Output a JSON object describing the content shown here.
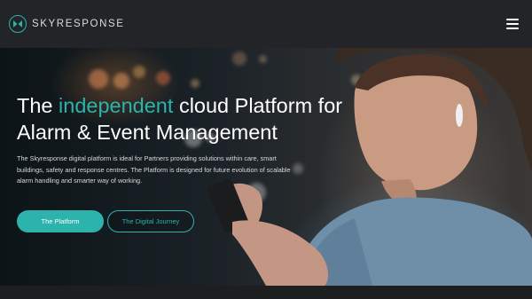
{
  "header": {
    "logo_text": "SKYRESPONSE",
    "logo_icon": "skyresponse-logo-icon",
    "menu_icon": "hamburger-menu-icon"
  },
  "hero": {
    "headline_part1": "The ",
    "headline_accent": "independent",
    "headline_part2": " cloud Platform for Alarm & Event Management",
    "description": "The Skyresponse digital platform is ideal for Partners providing solutions within care, smart buildings, safety and response centres. The Platform is designed for future evolution of scalable alarm handling and smarter way of working.",
    "primary_button_label": "The Platform",
    "secondary_button_label": "The Digital Journey"
  },
  "colors": {
    "accent": "#2bb3ac",
    "background": "#1e1f21",
    "navbar": "#232427"
  }
}
